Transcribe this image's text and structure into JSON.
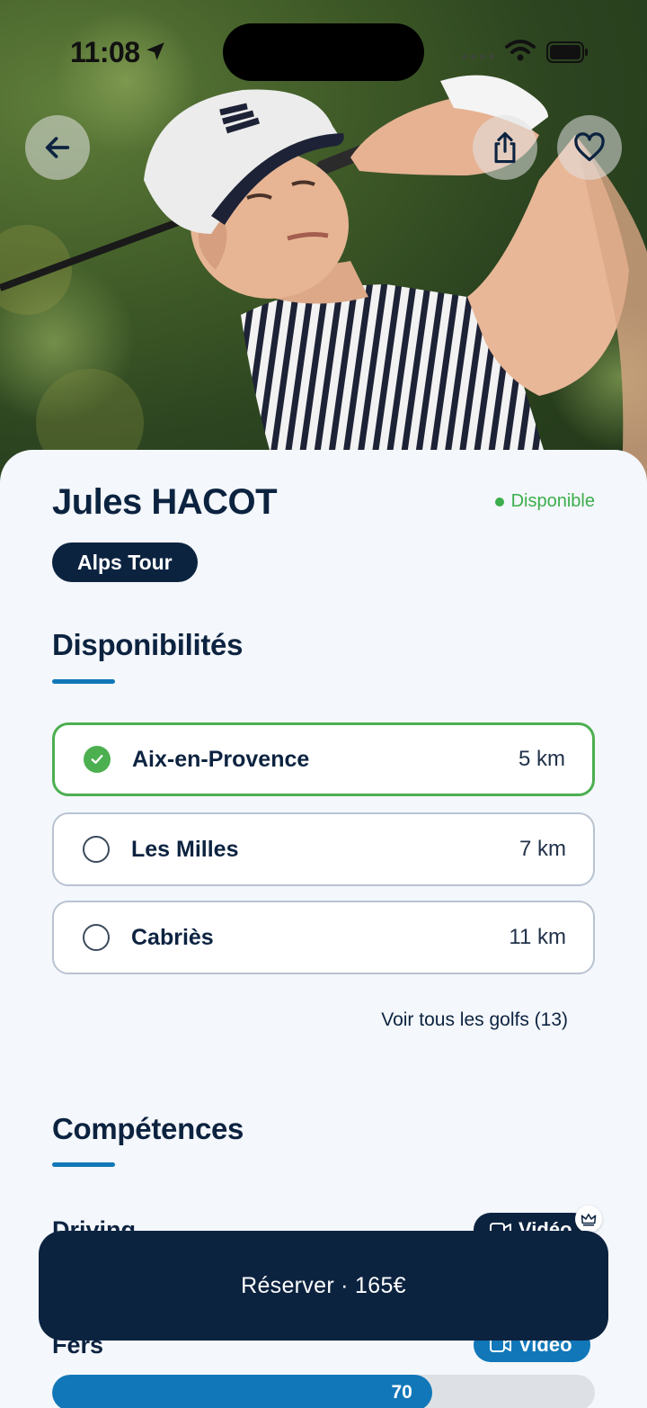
{
  "status_bar": {
    "time": "11:08"
  },
  "profile": {
    "name": "Jules HACOT",
    "availability_status": "Disponible",
    "tour_badge": "Alps Tour"
  },
  "availability": {
    "title": "Disponibilités",
    "golfs": [
      {
        "name": "Aix-en-Provence",
        "distance": "5 km",
        "selected": true
      },
      {
        "name": "Les Milles",
        "distance": "7 km",
        "selected": false
      },
      {
        "name": "Cabriès",
        "distance": "11 km",
        "selected": false
      }
    ],
    "see_all": "Voir tous les golfs (13)"
  },
  "skills": {
    "title": "Compétences",
    "items": [
      {
        "label": "Driving",
        "video_label": "Vidéo"
      },
      {
        "label": "Fers",
        "video_label": "Vidéo",
        "score": "70",
        "score_fraction": 0.7
      }
    ]
  },
  "cta": {
    "label": "Réserver · 165€"
  },
  "colors": {
    "navy": "#0c2340",
    "accent_blue": "#1177b8",
    "available_green": "#3cae4d"
  },
  "icons": [
    "location-arrow-icon",
    "signal-icon",
    "wifi-icon",
    "battery-icon",
    "back-arrow-icon",
    "share-icon",
    "heart-icon",
    "check-icon",
    "video-camera-icon",
    "crown-icon"
  ]
}
